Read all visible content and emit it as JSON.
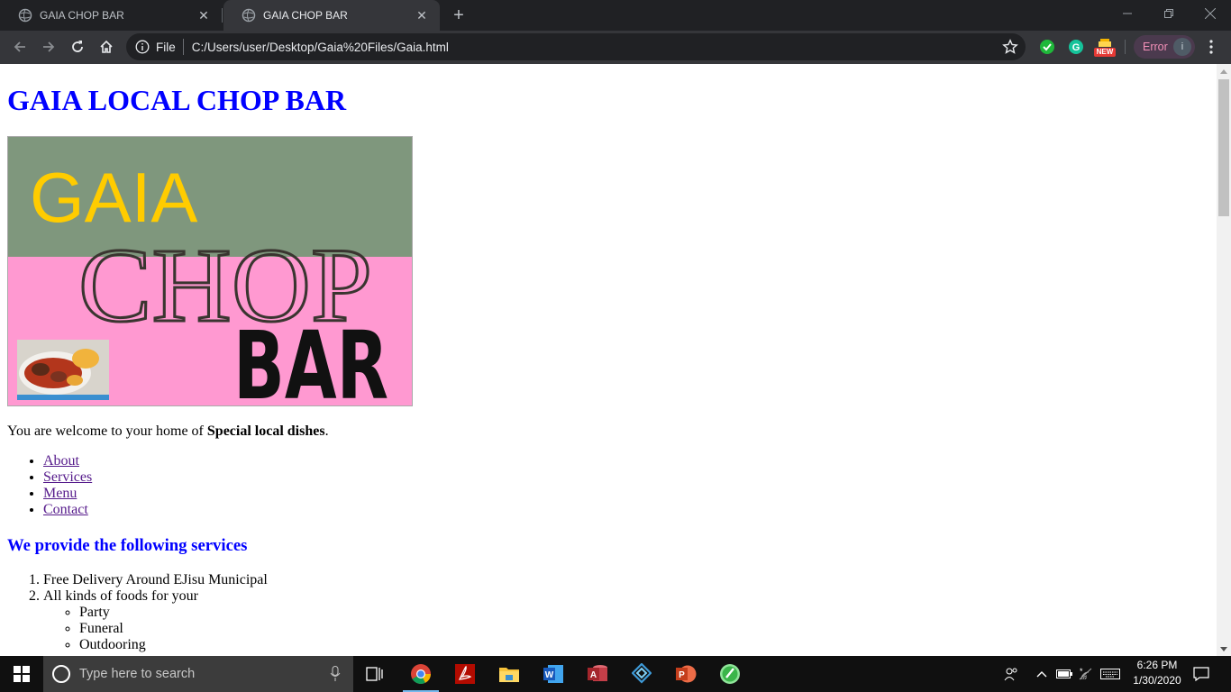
{
  "browser": {
    "tabs": [
      {
        "title": "GAIA CHOP BAR",
        "active": false
      },
      {
        "title": "GAIA CHOP BAR",
        "active": true
      }
    ],
    "address": {
      "scheme_label": "File",
      "url": "C:/Users/user/Desktop/Gaia%20Files/Gaia.html"
    },
    "extensions": [
      "check-extension-icon",
      "grammarly-icon",
      "new-badge-extension-icon"
    ],
    "new_badge": "NEW",
    "profile": {
      "status_label": "Error",
      "avatar_letter": "i"
    }
  },
  "page": {
    "heading": "GAIA LOCAL CHOP BAR",
    "banner": {
      "word1": "GAIA",
      "word2": "CHOP",
      "word3": "BAR",
      "colors": {
        "top": "#7f977d",
        "bottom": "#ff99d1",
        "gaia": "#ffcc00",
        "chop": "#3a3530",
        "bar": "#111111"
      }
    },
    "welcome_prefix": "You are welcome to your home of ",
    "welcome_bold": "Special local dishes",
    "welcome_suffix": ".",
    "nav_links": [
      "About",
      "Services",
      "Menu",
      "Contact"
    ],
    "services_heading": "We provide the following services",
    "services": [
      "Free Delivery Around EJisu Municipal",
      "All kinds of foods for your"
    ],
    "occasions": [
      "Party",
      "Funeral",
      "Outdooring"
    ],
    "heading_color": "#0000ff",
    "link_color": "#551a8b"
  },
  "taskbar": {
    "search_placeholder": "Type here to search",
    "time": "6:26 PM",
    "date": "1/30/2020",
    "apps": [
      "task-view-icon",
      "chrome-icon",
      "acrobat-icon",
      "file-explorer-icon",
      "word-icon",
      "access-icon",
      "sourcetree-icon",
      "powerpoint-icon",
      "notepadpp-icon"
    ]
  }
}
